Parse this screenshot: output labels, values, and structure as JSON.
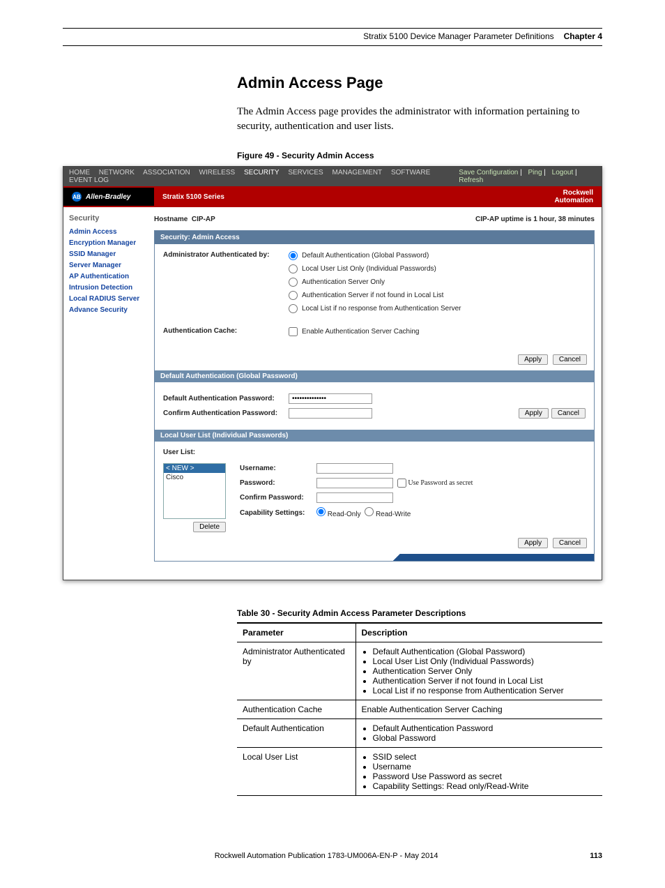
{
  "page_header": {
    "doc_title": "Stratix 5100 Device Manager Parameter Definitions",
    "chapter": "Chapter 4"
  },
  "section": {
    "title": "Admin Access Page",
    "intro": "The Admin Access page provides the administrator with information pertaining to security, authentication and user lists."
  },
  "figure": {
    "caption": "Figure 49 - Security Admin Access"
  },
  "ui": {
    "utils": {
      "save": "Save Configuration",
      "ping": "Ping",
      "logout": "Logout",
      "refresh": "Refresh"
    },
    "tabs": {
      "home": "HOME",
      "network": "NETWORK",
      "association": "ASSOCIATION",
      "wireless": "WIRELESS",
      "security": "SECURITY",
      "services": "SERVICES",
      "management": "MANAGEMENT",
      "software": "SOFTWARE",
      "eventlog": "EVENT LOG"
    },
    "brand_left": "Allen-Bradley",
    "brand_logo_text": "AB",
    "series": "Stratix 5100 Series",
    "brand_right_top": "Rockwell",
    "brand_right_bottom": "Automation",
    "side_head": "Security",
    "sidebar": {
      "admin_access": "Admin Access",
      "encryption_manager": "Encryption Manager",
      "ssid_manager": "SSID Manager",
      "server_manager": "Server Manager",
      "ap_authentication": "AP Authentication",
      "intrusion_detection": "Intrusion Detection",
      "local_radius": "Local RADIUS Server",
      "advance_security": "Advance Security"
    },
    "hostname_label": "Hostname",
    "hostname_value": "CIP-AP",
    "uptime": "CIP-AP uptime is 1 hour, 38 minutes",
    "panel1_head": "Security: Admin Access",
    "auth_by_label": "Administrator Authenticated by:",
    "auth_opts": {
      "default": "Default Authentication (Global Password)",
      "local": "Local User List Only (Individual Passwords)",
      "server_only": "Authentication Server Only",
      "server_if_not": "Authentication Server if not found in Local List",
      "local_if_no": "Local List if no response from Authentication Server"
    },
    "auth_cache_label": "Authentication Cache:",
    "auth_cache_opt": "Enable Authentication Server Caching",
    "apply": "Apply",
    "cancel": "Cancel",
    "subhead_default": "Default Authentication (Global Password)",
    "default_pwd_label": "Default Authentication Password:",
    "confirm_pwd_label": "Confirm Authentication Password:",
    "default_pwd_value": "••••••••••••••",
    "subhead_local": "Local User List (Individual Passwords)",
    "userlist_label": "User List:",
    "userlist_new": "< NEW >",
    "userlist_item1": "Cisco",
    "delete": "Delete",
    "username_label": "Username:",
    "password_label": "Password:",
    "confirm_password_label": "Confirm Password:",
    "use_secret": "Use Password as secret",
    "cap_label": "Capability Settings:",
    "cap_ro": "Read-Only",
    "cap_rw": "Read-Write"
  },
  "table": {
    "caption": "Table 30 - Security Admin Access Parameter Descriptions",
    "col1": "Parameter",
    "col2": "Description",
    "rows": {
      "r1p": "Administrator Authenticated by",
      "r1d1": "Default Authentication (Global Password)",
      "r1d2": "Local User List Only (Individual Passwords)",
      "r1d3": "Authentication Server Only",
      "r1d4": "Authentication Server if not found in Local List",
      "r1d5": "Local List if no response from Authentication Server",
      "r2p": "Authentication Cache",
      "r2d": "Enable Authentication Server Caching",
      "r3p": "Default Authentication",
      "r3d1": "Default Authentication Password",
      "r3d2": "Global Password",
      "r4p": "Local User List",
      "r4d1": "SSID select",
      "r4d2": "Username",
      "r4d3": "Password Use Password as secret",
      "r4d4": "Capability Settings: Read only/Read-Write"
    }
  },
  "footer": {
    "pub": "Rockwell Automation Publication 1783-UM006A-EN-P - May 2014",
    "page": "113"
  }
}
